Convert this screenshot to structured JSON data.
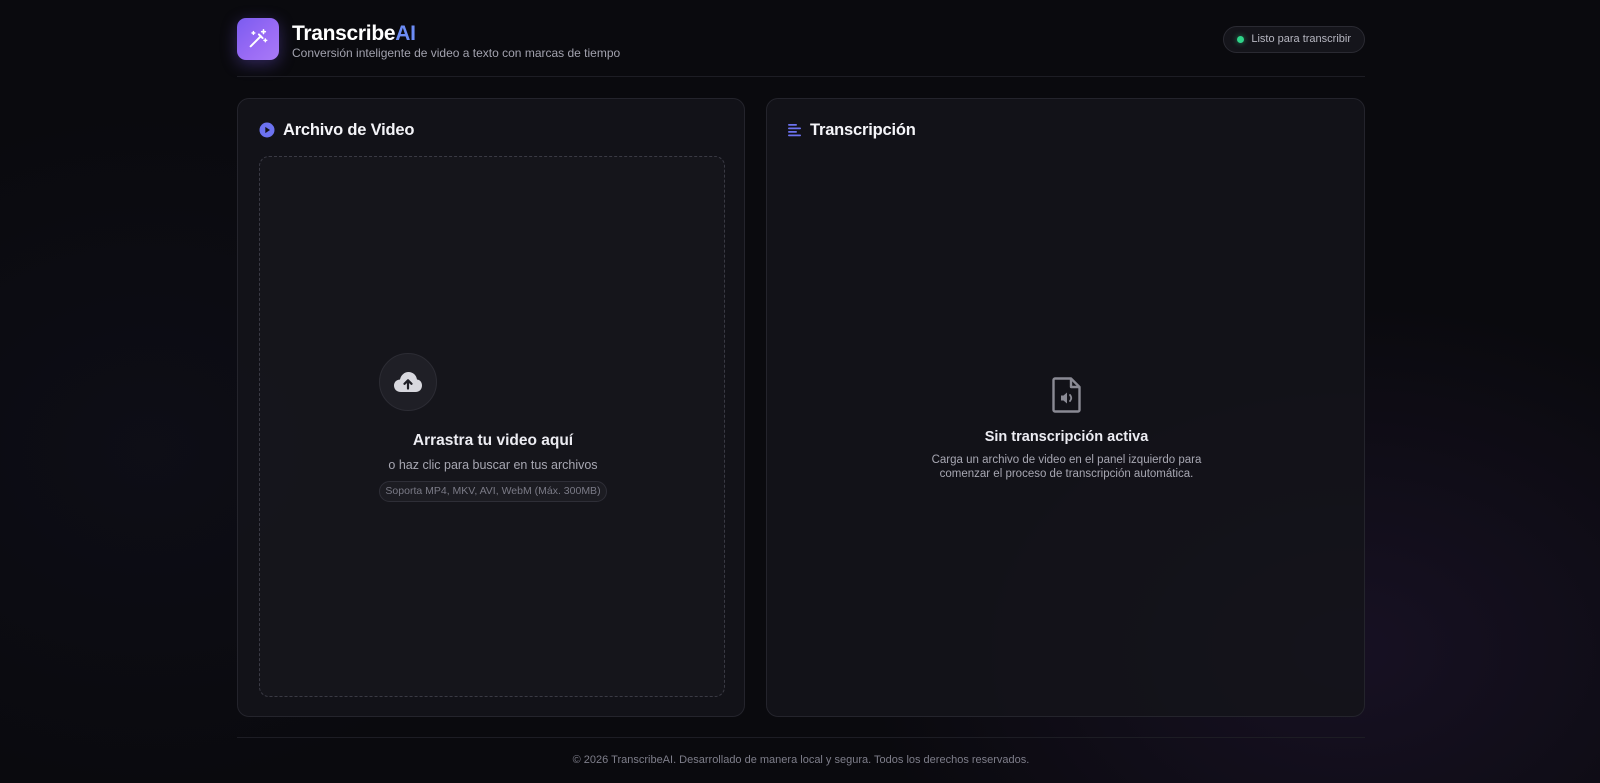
{
  "header": {
    "brand_main": "Transcribe",
    "brand_accent": "AI",
    "tagline": "Conversión inteligente de video a texto con marcas de tiempo",
    "status": "Listo para transcribir",
    "logo_icon": "magic-wand-sparkles-icon"
  },
  "video_panel": {
    "title": "Archivo de Video",
    "title_icon": "play-circle-icon",
    "dropzone": {
      "title": "Arrastra tu video aquí",
      "subtitle": "o haz clic para buscar en tus archivos",
      "formats": "Soporta MP4, MKV, AVI, WebM (Máx. 300MB)",
      "icon": "cloud-upload-icon"
    }
  },
  "transcript_panel": {
    "title": "Transcripción",
    "title_icon": "align-left-icon",
    "empty": {
      "title": "Sin transcripción activa",
      "description": "Carga un archivo de video en el panel izquierdo para comenzar el proceso de transcripción automática.",
      "icon": "file-audio-icon"
    }
  },
  "footer": {
    "text": "© 2026 TranscribeAI. Desarrollado de manera local y segura. Todos los derechos reservados."
  },
  "colors": {
    "accent": "#7b5cf0",
    "brand_ai": "#6c8cf5",
    "status_dot": "#2fd489",
    "background": "#0a0a0e"
  }
}
